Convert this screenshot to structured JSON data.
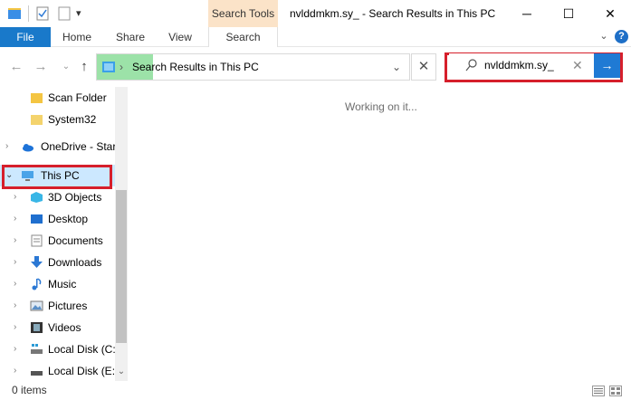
{
  "window": {
    "title": "nvlddmkm.sy_ - Search Results in This PC",
    "context_tab": "Search Tools"
  },
  "ribbon": {
    "file": "File",
    "home": "Home",
    "share": "Share",
    "view": "View",
    "search": "Search"
  },
  "address": {
    "path": "Search Results in This PC"
  },
  "search": {
    "value": "nvlddmkm.sy_"
  },
  "sidebar": {
    "items": [
      {
        "label": "Scan Folder",
        "icon": "folder-icon"
      },
      {
        "label": "System32",
        "icon": "folder-icon"
      },
      {
        "label": "OneDrive - Star",
        "icon": "onedrive-icon"
      },
      {
        "label": "This PC",
        "icon": "this-pc-icon"
      },
      {
        "label": "3D Objects",
        "icon": "3d-objects-icon"
      },
      {
        "label": "Desktop",
        "icon": "desktop-icon"
      },
      {
        "label": "Documents",
        "icon": "documents-icon"
      },
      {
        "label": "Downloads",
        "icon": "downloads-icon"
      },
      {
        "label": "Music",
        "icon": "music-icon"
      },
      {
        "label": "Pictures",
        "icon": "pictures-icon"
      },
      {
        "label": "Videos",
        "icon": "videos-icon"
      },
      {
        "label": "Local Disk (C:",
        "icon": "local-disk-icon"
      },
      {
        "label": "Local Disk (E:)",
        "icon": "local-disk-icon"
      }
    ]
  },
  "main": {
    "status_message": "Working on it..."
  },
  "statusbar": {
    "count": "0 items"
  },
  "colors": {
    "accent": "#1979ca",
    "highlight": "#d61f2b",
    "context_tab": "#fbe3c8",
    "address_progress": "#9ce2a8",
    "selected": "#cce8ff"
  }
}
